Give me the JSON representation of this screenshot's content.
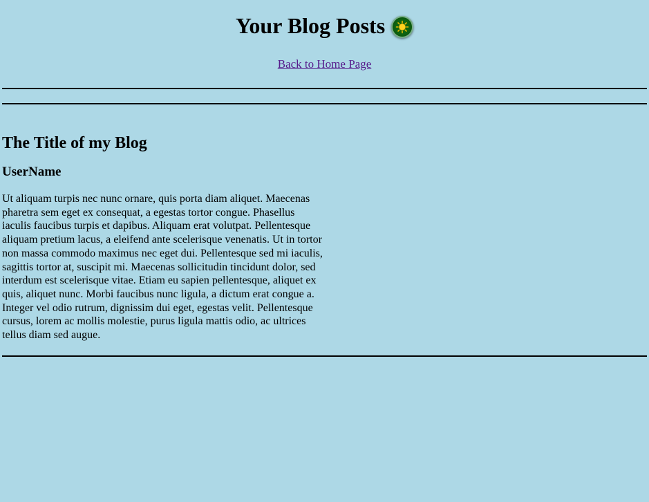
{
  "header": {
    "title": "Your Blog Posts",
    "theme_toggle_icon": "sun-icon",
    "accent_color": "#0f6410"
  },
  "nav": {
    "home_link": "Back to Home Page"
  },
  "posts": [
    {
      "title": "The Title of my Blog",
      "author": "UserName",
      "body": "Ut aliquam turpis nec nunc ornare, quis porta diam aliquet. Maecenas pharetra sem eget ex consequat, a egestas tortor congue. Phasellus iaculis faucibus turpis et dapibus. Aliquam erat volutpat. Pellentesque aliquam pretium lacus, a eleifend ante scelerisque venenatis. Ut in tortor non massa commodo maximus nec eget dui. Pellentesque sed mi iaculis, sagittis tortor at, suscipit mi. Maecenas sollicitudin tincidunt dolor, sed interdum est scelerisque vitae. Etiam eu sapien pellentesque, aliquet ex quis, aliquet nunc. Morbi faucibus nunc ligula, a dictum erat congue a. Integer vel odio rutrum, dignissim dui eget, egestas velit. Pellentesque cursus, lorem ac mollis molestie, purus ligula mattis odio, ac ultrices tellus diam sed augue."
    }
  ],
  "colors": {
    "background": "#add8e6",
    "link": "#551a8b",
    "text": "#000000"
  }
}
